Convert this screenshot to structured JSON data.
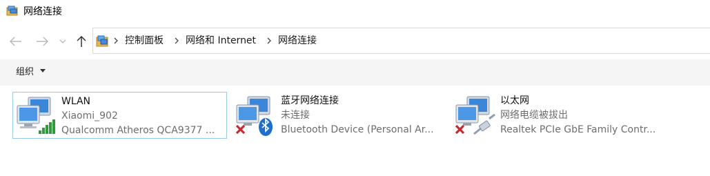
{
  "window": {
    "title": "网络连接",
    "icon": "network-connections-icon"
  },
  "navigation": {
    "back_icon": "arrow-left-icon",
    "forward_icon": "arrow-right-icon",
    "recent_icon": "chevron-down-icon",
    "up_icon": "arrow-up-icon"
  },
  "address": {
    "icon": "network-folder-icon",
    "breadcrumbs": [
      "控制面板",
      "网络和 Internet",
      "网络连接"
    ]
  },
  "toolbar": {
    "organize_label": "组织",
    "organize_icon": "caret-down-icon"
  },
  "connections": [
    {
      "name": "WLAN",
      "status": "Xiaomi_902",
      "device": "Qualcomm Atheros QCA9377 ...",
      "icon": "wifi-signal-icon",
      "selected": true
    },
    {
      "name": "蓝牙网络连接",
      "status": "未连接",
      "device": "Bluetooth Device (Personal Ar...",
      "icon": "bluetooth-icon",
      "selected": false
    },
    {
      "name": "以太网",
      "status": "网络电缆被拔出",
      "device": "Realtek PCIe GbE Family Contr...",
      "icon": "ethernet-cable-icon",
      "selected": false
    }
  ],
  "colors": {
    "selection_border": "#99c9ea",
    "toolbar_bg": "#f5f5f5",
    "signal_green": "#2e9e3a",
    "error_red": "#d3232c",
    "bluetooth_blue": "#1a6fd1"
  }
}
